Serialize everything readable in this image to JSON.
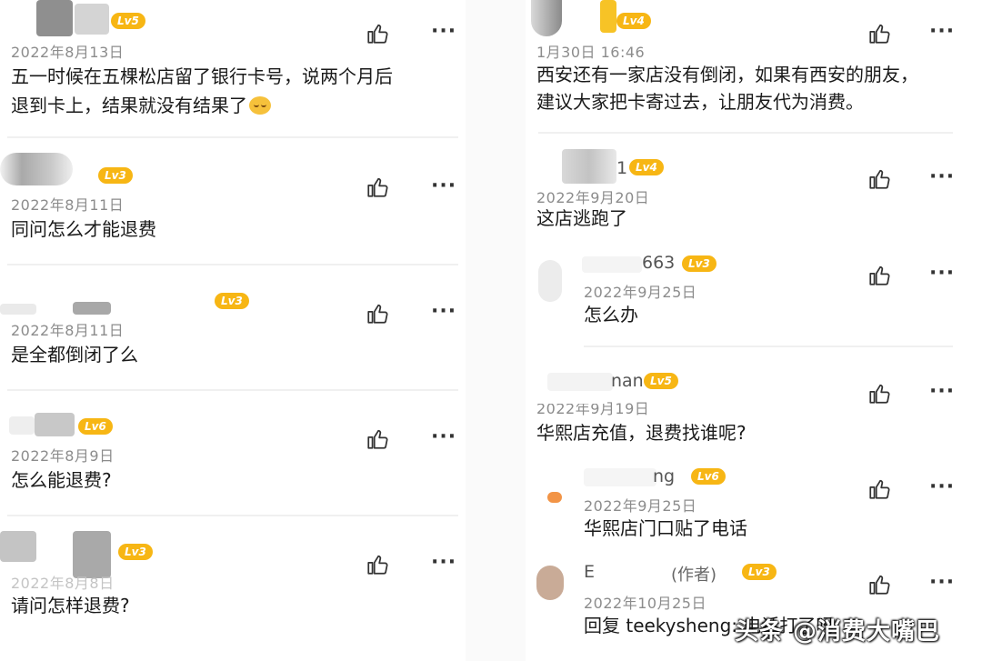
{
  "left_comments": [
    {
      "level": "Lv5",
      "date": "2022年8月13日",
      "lines": [
        "五一时候在五棵松店留了银行卡号，说两个月后",
        "退到卡上，结果就没有结果了"
      ]
    },
    {
      "level": "Lv3",
      "date": "2022年8月11日",
      "lines": [
        "同问怎么才能退费"
      ]
    },
    {
      "level": "Lv3",
      "date": "2022年8月11日",
      "lines": [
        "是全都倒闭了么"
      ]
    },
    {
      "level": "Lv6",
      "date": "2022年8月9日",
      "lines": [
        "怎么能退费?"
      ]
    },
    {
      "level": "Lv3",
      "date": "2022年8月8日",
      "lines": [
        "请问怎样退费?"
      ]
    }
  ],
  "right_comments": [
    {
      "level": "Lv4",
      "date": "1月30日 16:46",
      "lines": [
        "西安还有一家店没有倒闭，如果有西安的朋友，",
        "建议大家把卡寄过去，让朋友代为消费。"
      ]
    },
    {
      "name": "1",
      "level": "Lv4",
      "date": "2022年9月20日",
      "lines": [
        "这店逃跑了"
      ]
    },
    {
      "name": "663",
      "level": "Lv3",
      "date": "2022年9月25日",
      "lines": [
        "怎么办"
      ]
    },
    {
      "name": "nan",
      "level": "Lv5",
      "date": "2022年9月19日",
      "lines": [
        "华熙店充值，退费找谁呢?"
      ]
    },
    {
      "name": "ng",
      "level": "Lv6",
      "date": "2022年9月25日",
      "lines": [
        "华熙店门口贴了电话"
      ]
    },
    {
      "name": "E",
      "author_tag": "(作者)",
      "level": "Lv3",
      "date": "2022年10月25日",
      "lines": [
        "回复 teekysheng: 电话打了吗"
      ]
    }
  ],
  "watermark": "头条 @消费大嘴巴",
  "colors": {
    "level_badge": "#f7b614",
    "date": "#8c8c8c",
    "divider": "#f0f0f0"
  },
  "icons": {
    "like": "thumbs-up-icon",
    "more": "more-dots-icon"
  }
}
